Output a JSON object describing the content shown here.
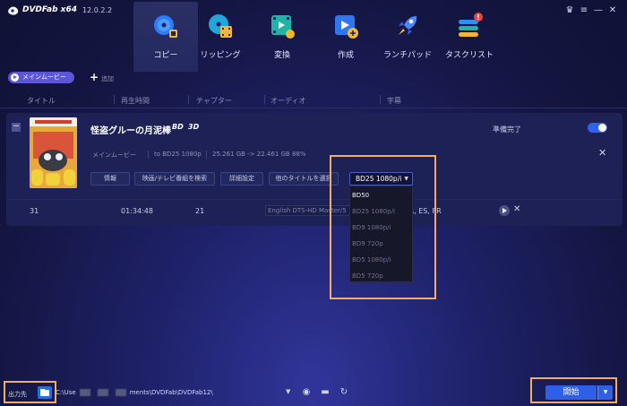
{
  "app": {
    "name": "DVDFab x64",
    "version": "12.0.2.2"
  },
  "toolbar": {
    "items": [
      {
        "label": "コピー",
        "active": true
      },
      {
        "label": "リッピング"
      },
      {
        "label": "変換"
      },
      {
        "label": "作成"
      },
      {
        "label": "ランチパッド"
      },
      {
        "label": "タスクリスト",
        "badge": "!"
      }
    ]
  },
  "mode": {
    "label": "メインムービー",
    "add_label": "追加"
  },
  "columns": [
    "タイトル",
    "再生時間",
    "チャプター",
    "オーディオ",
    "字幕"
  ],
  "title_card": {
    "movie_title": "怪盗グルーの月泥棒",
    "bd_badge": "BD",
    "badge_3d": "3D",
    "status": "準備完了",
    "toggle_on": true,
    "info": {
      "mode": "メインムービー",
      "target": "to BD25 1080p",
      "size": "25.261 GB -> 22.461 GB 88%"
    },
    "buttons": {
      "info": "情報",
      "search": "映画/テレビ番組を検索",
      "settings": "詳細設定",
      "other_title": "他のタイトルを選択"
    },
    "row": {
      "title": "31",
      "duration": "01:34:48",
      "chapters": "21",
      "audio": "English DTS-HD Master/5",
      "subtitles": "FR, ES, FR"
    }
  },
  "output_dropdown": {
    "selected": "BD25 1080p/i",
    "options": [
      "BD50",
      "BD25 1080p/i",
      "BD9 1080p/i",
      "BD9 720p",
      "BD5 1080p/i",
      "BD5 720p"
    ],
    "highlighted_option": "BD50"
  },
  "bottom": {
    "output_label": "出力先",
    "path_start": "C:\\Use",
    "path_end": "ments\\DVDFab\\DVDFab12\\",
    "start_label": "開始"
  },
  "colors": {
    "accent": "#2e5fe6",
    "annotation": "#f2ad63",
    "mode_button": "#5b56d6"
  },
  "icons": [
    "copy-disc-icon",
    "ripper-film-icon",
    "converter-film-icon",
    "creator-disc-icon",
    "launchpad-rocket-icon",
    "task-list-icon"
  ]
}
